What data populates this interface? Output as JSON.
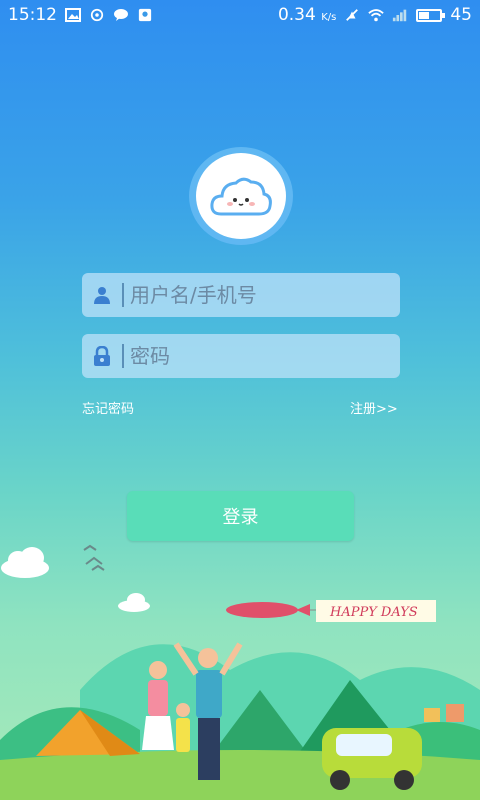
{
  "status_bar": {
    "time": "15:12",
    "speed": "0.34",
    "speed_unit": "K/s",
    "battery": "45",
    "battery_level": 0.45,
    "icons": [
      "image-icon",
      "sync-icon",
      "chat-icon",
      "notification-icon",
      "mute-icon",
      "wifi-icon",
      "signal-icon",
      "battery-icon"
    ]
  },
  "login": {
    "username_placeholder": "用户名/手机号",
    "password_placeholder": "密码",
    "forgot_password": "忘记密码",
    "register": "注册>>",
    "login_button": "登录"
  },
  "banner": {
    "text": "HAPPY DAYS"
  },
  "colors": {
    "accent_button": "#59ddb8",
    "input_bg": "#bee1f8",
    "icon_blue": "#3a7fd0"
  }
}
